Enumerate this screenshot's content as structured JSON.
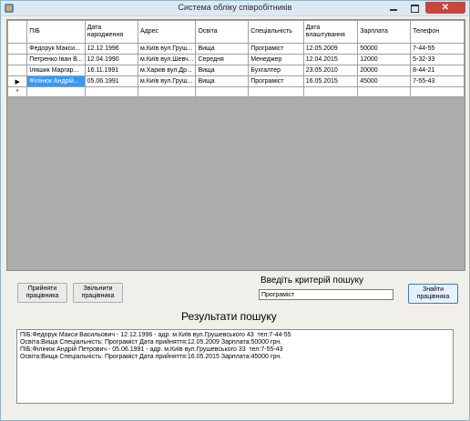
{
  "window": {
    "title": "Система обліку співробітників",
    "close_label": "✕"
  },
  "grid": {
    "columns": [
      "ПІБ",
      "Дата народження",
      "Адрес",
      "Освіта",
      "Спеціальність",
      "Дата влаштування",
      "Зарплата",
      "Телефон"
    ],
    "rows": [
      {
        "marker": "",
        "cells": [
          "Федорук Макси...",
          "12.12.1996",
          "м.Київ вул.Груш...",
          "Вища",
          "Програміст",
          "12.05.2009",
          "50000",
          "7-44-55"
        ]
      },
      {
        "marker": "",
        "cells": [
          "Петренко Іван В...",
          "12.04.1990",
          "м.Київ вул.Шевч...",
          "Середня",
          "Менеджер",
          "12.04.2015",
          "12000",
          "5-32-33"
        ]
      },
      {
        "marker": "",
        "cells": [
          "Іляшик Маргар...",
          "16.11.1991",
          "м.Харків вул.Др...",
          "Вища",
          "Бухгалтер",
          "23.05.2010",
          "20000",
          "8-44-21"
        ]
      },
      {
        "marker": "▶",
        "cells": [
          "Філінюк Андрій...",
          "05.06.1991",
          "м.Київ вул.Груш...",
          "Вища",
          "Програміст",
          "16.05.2015",
          "45000",
          "7-55-43"
        ]
      }
    ],
    "new_row_marker": "*"
  },
  "buttons": {
    "hire": "Прийняти працівника",
    "fire": "Звільнити працівника",
    "find": "Знайти працівника"
  },
  "search": {
    "label": "Введіть критерій пошуку",
    "value": "Програміст"
  },
  "results": {
    "title": "Результати пошуку",
    "lines": [
      "ПІБ:Федорук Макси Васильович - 12.12.1996 - адр. м.Київ вул.Грушевського 43  тел:7-44-55",
      "Освіта:Вища Спеціальність: Програміст Дата прийняття:12.05.2009 Зарплата:50000 грн.",
      "ПІБ:Філінюк Андрій Петрович - 05.06.1991 - адр. м.Київ вул.Грушевського 33  тел:7-55-43",
      "Освіта:Вища Спеціальність: Програміст Дата прийняття:16.05.2015 Зарплата:45000 грн."
    ]
  }
}
